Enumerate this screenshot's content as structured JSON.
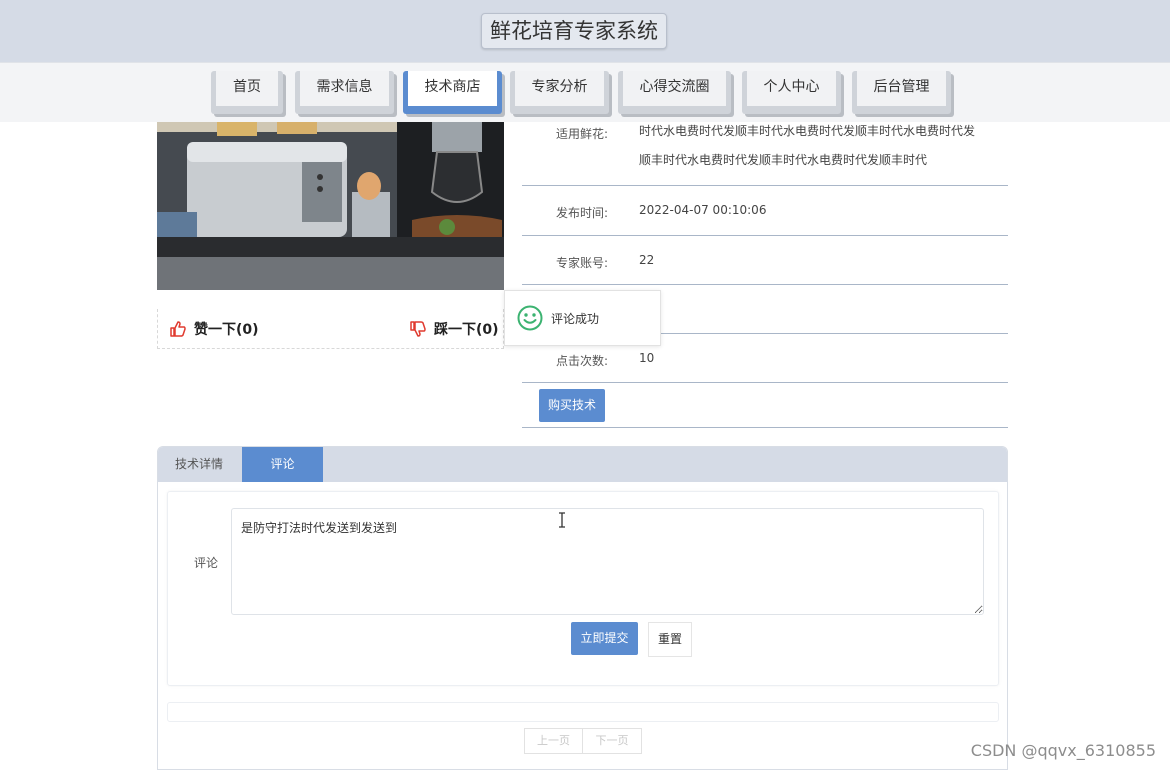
{
  "header": {
    "title": "鲜花培育专家系统"
  },
  "nav": {
    "items": [
      "首页",
      "需求信息",
      "技术商店",
      "专家分析",
      "心得交流圈",
      "个人中心",
      "后台管理"
    ],
    "active": "技术商店"
  },
  "votes": {
    "like": "赞一下(0)",
    "dislike": "踩一下(0)"
  },
  "info": {
    "flower_label": "适用鲜花:",
    "flower_line1": "时代水电费时代发顺丰时代水电费时代发顺丰时代水电费时代发",
    "flower_line2": "顺丰时代水电费时代发顺丰时代水电费时代发顺丰时代",
    "time_label": "发布时间:",
    "time_value": "2022-04-07 00:10:06",
    "expert_label": "专家账号:",
    "expert_value": "22",
    "clicks_label": "点击次数:",
    "clicks_value": "10",
    "buy_button": "购买技术"
  },
  "toast": {
    "message": "评论成功"
  },
  "tabs": {
    "detail": "技术详情",
    "comment": "评论"
  },
  "comment_form": {
    "label": "评论",
    "value": "是防守打法时代发送到发送到",
    "submit": "立即提交",
    "reset": "重置"
  },
  "pager": {
    "prev": "上一页",
    "next": "下一页"
  },
  "watermark": "CSDN @qqvx_6310855",
  "colors": {
    "accent": "#5b8cd0",
    "header_bg": "#d5dbe6",
    "toast_icon": "#3cb371",
    "vote_icon": "#e03a2f"
  }
}
